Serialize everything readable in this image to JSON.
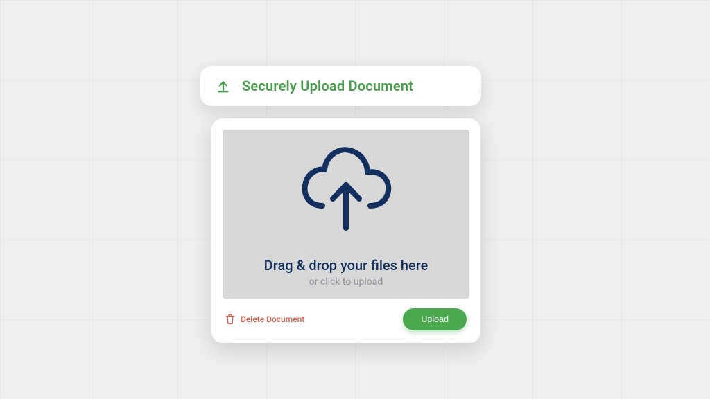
{
  "header": {
    "title": "Securely Upload Document"
  },
  "dropzone": {
    "title": "Drag & drop your files here",
    "subtitle": "or click to upload"
  },
  "actions": {
    "delete_label": "Delete Document",
    "upload_label": "Upload"
  },
  "colors": {
    "accent_green": "#44a048",
    "button_green": "#4aa84e",
    "navy": "#12305f",
    "danger": "#e05b4a",
    "panel_bg": "#ffffff",
    "drop_bg": "#d8d8d8",
    "page_bg": "#efefef"
  }
}
